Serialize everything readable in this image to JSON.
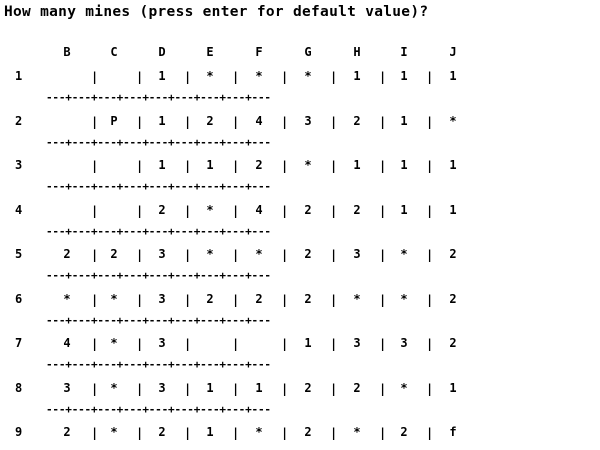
{
  "prompt": "How many mines (press enter for default value)?",
  "board": {
    "column_headers": [
      "B",
      "C",
      "D",
      "E",
      "F",
      "G",
      "H",
      "I",
      "J"
    ],
    "row_labels": [
      "1",
      "2",
      "3",
      "4",
      "5",
      "6",
      "7",
      "8",
      "9"
    ],
    "rows": [
      [
        "",
        "",
        "1",
        "*",
        "*",
        "*",
        "1",
        "1",
        "1"
      ],
      [
        "",
        "P",
        "1",
        "2",
        "4",
        "3",
        "2",
        "1",
        "*"
      ],
      [
        "",
        "",
        "1",
        "1",
        "2",
        "*",
        "1",
        "1",
        "1"
      ],
      [
        "",
        "",
        "2",
        "*",
        "4",
        "2",
        "2",
        "1",
        "1"
      ],
      [
        "2",
        "2",
        "3",
        "*",
        "*",
        "2",
        "3",
        "*",
        "2"
      ],
      [
        "*",
        "*",
        "3",
        "2",
        "2",
        "2",
        "*",
        "*",
        "2"
      ],
      [
        "4",
        "*",
        "3",
        "",
        "",
        "1",
        "3",
        "3",
        "2"
      ],
      [
        "3",
        "*",
        "3",
        "1",
        "1",
        "2",
        "2",
        "*",
        "1"
      ],
      [
        "2",
        "*",
        "2",
        "1",
        "*",
        "2",
        "*",
        "2",
        "f"
      ]
    ],
    "separator": "---+---+---+---+---+---+---+---+---"
  }
}
